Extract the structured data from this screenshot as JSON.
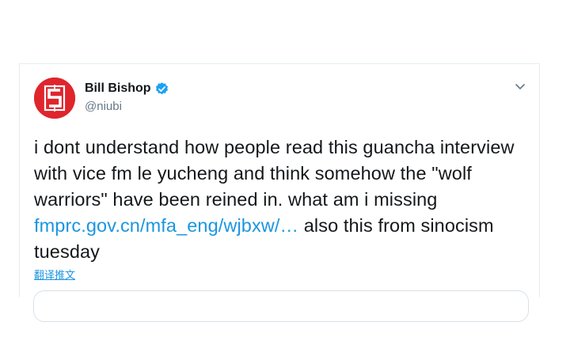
{
  "tweet": {
    "display_name": "Bill Bishop",
    "handle": "@niubi",
    "text_part1": "i dont understand how people read this guancha interview with vice fm le yucheng and think somehow the \"wolf warriors\" have been reined in. what am i missing ",
    "link": "fmprc.gov.cn/mfa_eng/wjbxw/…",
    "text_part2": " also this from sinocism tuesday",
    "translate_label": "翻译推文"
  },
  "icons": {
    "avatar": "sinocism-logo-avatar",
    "verified": "verified-badge-icon",
    "menu": "chevron-down-icon"
  },
  "colors": {
    "link": "#1b95e0",
    "avatar_bg": "#e0252c",
    "verified": "#1da1f2",
    "text": "#14171a",
    "muted": "#657786"
  }
}
